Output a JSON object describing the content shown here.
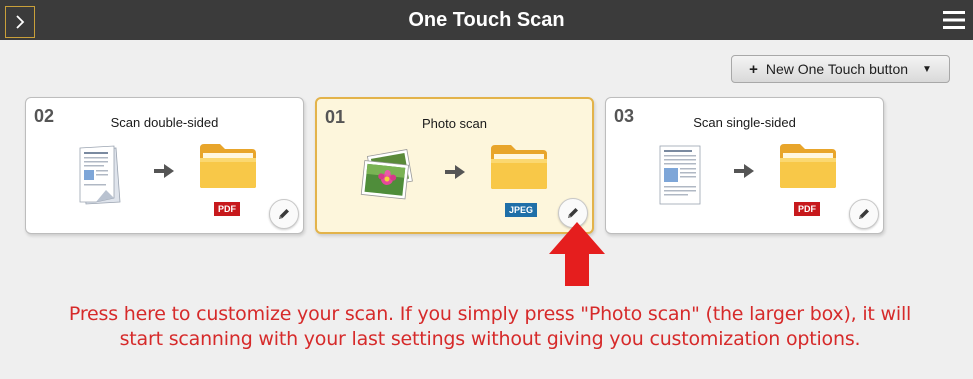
{
  "window": {
    "title": "One Touch Scan",
    "expand_icon": "chevron-right-icon",
    "menu_icon": "hamburger-menu-icon"
  },
  "toolbar": {
    "new_button_label": "New One Touch button",
    "new_button_icon": "plus-icon",
    "dropdown_icon": "caret-down-icon"
  },
  "cards": [
    {
      "number": "02",
      "name": "Scan double-sided",
      "format": "PDF",
      "source_icon": "double-sided-document-icon",
      "selected": false
    },
    {
      "number": "01",
      "name": "Photo scan",
      "format": "JPEG",
      "source_icon": "photos-icon",
      "selected": true
    },
    {
      "number": "03",
      "name": "Scan single-sided",
      "format": "PDF",
      "source_icon": "single-sided-document-icon",
      "selected": false
    }
  ],
  "annotation": {
    "text": "Press here to customize your scan. If you simply press \"Photo scan\" (the larger box), it will start scanning with your last settings without giving you customization options.",
    "color": "#d62a2a"
  },
  "colors": {
    "titlebar": "#3b3b3b",
    "selected_card_border": "#e3b34a",
    "selected_card_bg": "#fdf6dc",
    "pdf_badge": "#c7191c",
    "jpeg_badge": "#1f6fa8"
  }
}
